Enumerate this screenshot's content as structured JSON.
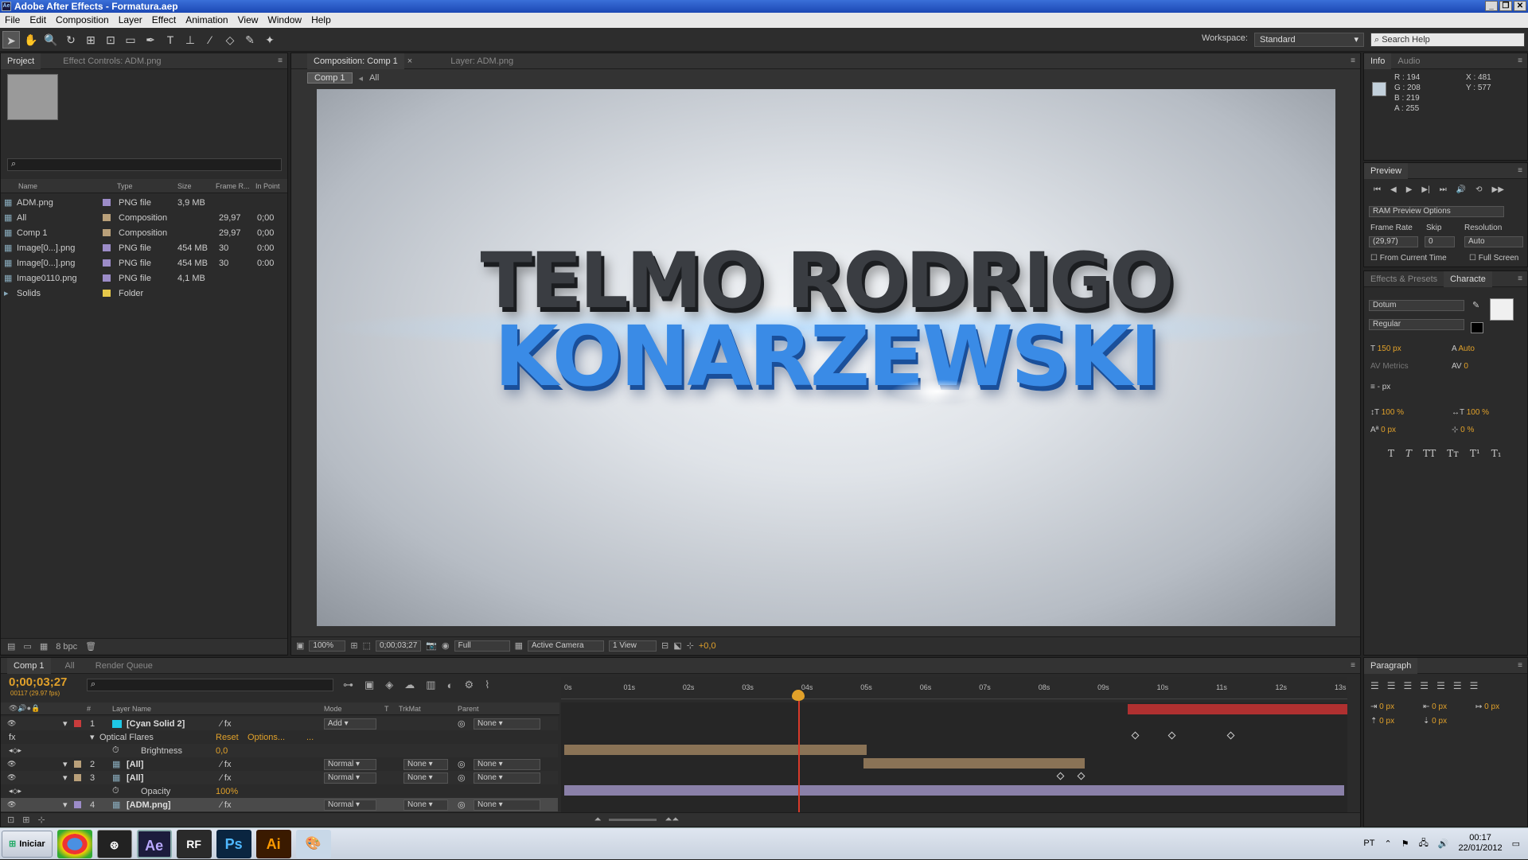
{
  "window": {
    "title": "Adobe After Effects - Formatura.aep"
  },
  "menu": [
    "File",
    "Edit",
    "Composition",
    "Layer",
    "Effect",
    "Animation",
    "View",
    "Window",
    "Help"
  ],
  "toolbar": {
    "workspace_label": "Workspace:",
    "workspace_value": "Standard",
    "search_placeholder": "Search Help"
  },
  "project": {
    "tabs": [
      "Project",
      "Effect Controls: ADM.png"
    ],
    "columns": [
      "Name",
      "Type",
      "Size",
      "Frame R...",
      "In Point"
    ],
    "items": [
      {
        "name": "ADM.png",
        "type": "PNG file",
        "size": "3,9 MB",
        "rate": "",
        "in": "",
        "color": "#9c8cc8"
      },
      {
        "name": "All",
        "type": "Composition",
        "size": "",
        "rate": "29,97",
        "in": "0;00",
        "color": "#b9a07a"
      },
      {
        "name": "Comp 1",
        "type": "Composition",
        "size": "",
        "rate": "29,97",
        "in": "0;00",
        "color": "#b9a07a"
      },
      {
        "name": "Image[0...].png",
        "type": "PNG file",
        "size": "454 MB",
        "rate": "30",
        "in": "0:00",
        "color": "#9c8cc8"
      },
      {
        "name": "Image[0...].png",
        "type": "PNG file",
        "size": "454 MB",
        "rate": "30",
        "in": "0:00",
        "color": "#9c8cc8"
      },
      {
        "name": "Image0110.png",
        "type": "PNG file",
        "size": "4,1 MB",
        "rate": "",
        "in": "",
        "color": "#9c8cc8"
      },
      {
        "name": "Solids",
        "type": "Folder",
        "size": "",
        "rate": "",
        "in": "",
        "color": "#e6c84a"
      }
    ],
    "bpc": "8 bpc"
  },
  "comp": {
    "tabs": [
      "Composition: Comp 1",
      "Layer: ADM.png"
    ],
    "breadcrumb": [
      "Comp 1",
      "All"
    ],
    "title_line1": "TELMO RODRIGO",
    "title_line2": "KONARZEWSKI",
    "footer": {
      "zoom": "100%",
      "timecode": "0;00;03;27",
      "resolution": "Full",
      "camera": "Active Camera",
      "views": "1 View",
      "exposure": "+0,0"
    }
  },
  "info": {
    "tabs": [
      "Info",
      "Audio"
    ],
    "r": "R : 194",
    "g": "G : 208",
    "b": "B : 219",
    "a": "A : 255",
    "x": "X : 481",
    "y": "Y : 577",
    "swatch": "#c2d0db"
  },
  "preview": {
    "tab": "Preview",
    "options": "RAM Preview Options",
    "frame_rate_label": "Frame Rate",
    "skip_label": "Skip",
    "resolution_label": "Resolution",
    "frame_rate": "(29,97)",
    "skip": "0",
    "resolution": "Auto",
    "from_current": "From Current Time",
    "full_screen": "Full Screen"
  },
  "character": {
    "tabs": [
      "Effects & Presets",
      "Characte"
    ],
    "font": "Dotum",
    "style": "Regular",
    "size": "150 px",
    "leading": "Auto",
    "kerning": "Metrics",
    "tracking": "0",
    "stroke": "- px",
    "vscale": "100 %",
    "hscale": "100 %",
    "baseline": "0 px",
    "tsume": "0 %"
  },
  "paragraph": {
    "tab": "Paragraph",
    "indent1": "0 px",
    "indent2": "0 px",
    "indent3": "0 px",
    "space1": "0 px",
    "space2": "0 px"
  },
  "timeline": {
    "tabs": [
      "Comp 1",
      "All",
      "Render Queue"
    ],
    "timecode": "0;00;03;27",
    "fps": "00117 (29.97 fps)",
    "col_layer": "Layer Name",
    "col_mode": "Mode",
    "col_t": "T",
    "col_trkmat": "TrkMat",
    "col_parent": "Parent",
    "ruler": [
      "0s",
      "01s",
      "02s",
      "03s",
      "04s",
      "05s",
      "06s",
      "07s",
      "08s",
      "09s",
      "10s",
      "11s",
      "12s",
      "13s"
    ],
    "layers": [
      {
        "num": "1",
        "name": "[Cyan Solid 2]",
        "mode": "Add",
        "trk": "",
        "parent": "None",
        "color": "#c83c3c",
        "icon": "#1ec8e6"
      },
      {
        "num": "",
        "name": "Optical Flares",
        "mode": "",
        "trk": "",
        "parent": "",
        "reset": "Reset",
        "options": "Options...",
        "dots": "..."
      },
      {
        "num": "",
        "name": "Brightness",
        "value": "0,0"
      },
      {
        "num": "2",
        "name": "[All]",
        "mode": "Normal",
        "trk": "None",
        "parent": "None",
        "color": "#b9a07a"
      },
      {
        "num": "3",
        "name": "[All]",
        "mode": "Normal",
        "trk": "None",
        "parent": "None",
        "color": "#b9a07a"
      },
      {
        "num": "",
        "name": "Opacity",
        "value": "100%"
      },
      {
        "num": "4",
        "name": "[ADM.png]",
        "mode": "Normal",
        "trk": "None",
        "parent": "None",
        "color": "#9c8cc8"
      }
    ]
  },
  "taskbar": {
    "start": "Iniciar",
    "lang": "PT",
    "time": "00:17",
    "date": "22/01/2012",
    "apps": [
      "Chrome",
      "Bridge",
      "Ae",
      "RF",
      "Ps",
      "Ai",
      "Paint"
    ]
  }
}
